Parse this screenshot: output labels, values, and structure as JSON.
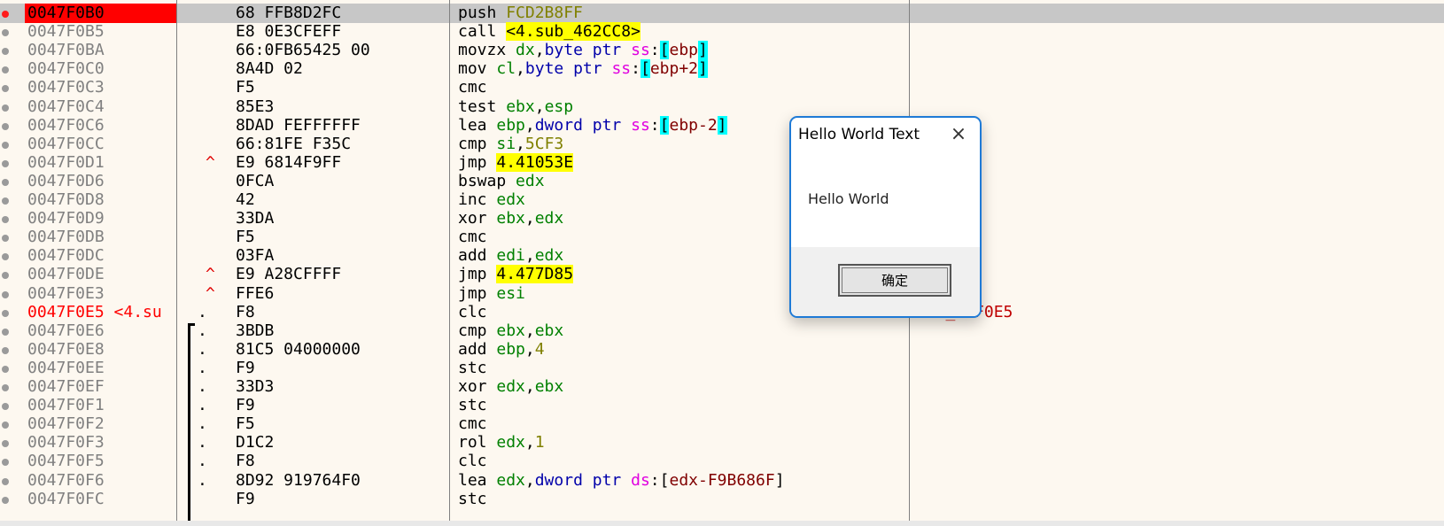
{
  "disassembly": {
    "rows": [
      {
        "addr": "0047F0B0",
        "bytes": "68 FFB8D2FC",
        "mark": "",
        "dot": "",
        "comment": "",
        "state": "current",
        "instr": [
          {
            "t": "push",
            "c": "mn push"
          },
          {
            "t": " ",
            "c": "tx"
          },
          {
            "t": "FCD2B8FF",
            "c": "num"
          }
        ]
      },
      {
        "addr": "0047F0B5",
        "bytes": "E8 0E3CFEFF",
        "mark": "",
        "dot": "",
        "comment": "",
        "state": "",
        "instr": [
          {
            "t": "call",
            "c": "mn call"
          },
          {
            "t": " ",
            "c": "tx"
          },
          {
            "t": "<4.sub_462CC8>",
            "c": "tgtc"
          }
        ]
      },
      {
        "addr": "0047F0BA",
        "bytes": "66:0FB65425 00",
        "mark": "",
        "dot": "",
        "comment": "",
        "state": "",
        "instr": [
          {
            "t": "movzx",
            "c": "mn"
          },
          {
            "t": " ",
            "c": "tx"
          },
          {
            "t": "dx",
            "c": "reg"
          },
          {
            "t": ",",
            "c": "tx"
          },
          {
            "t": "byte ptr",
            "c": "sz"
          },
          {
            "t": " ",
            "c": "tx"
          },
          {
            "t": "ss",
            "c": "seg"
          },
          {
            "t": ":",
            "c": "tx"
          },
          {
            "t": "[",
            "c": "br"
          },
          {
            "t": "ebp",
            "c": "mem"
          },
          {
            "t": "]",
            "c": "br"
          }
        ]
      },
      {
        "addr": "0047F0C0",
        "bytes": "8A4D 02",
        "mark": "",
        "dot": "",
        "comment": "",
        "state": "",
        "instr": [
          {
            "t": "mov",
            "c": "mn"
          },
          {
            "t": " ",
            "c": "tx"
          },
          {
            "t": "cl",
            "c": "reg"
          },
          {
            "t": ",",
            "c": "tx"
          },
          {
            "t": "byte ptr",
            "c": "sz"
          },
          {
            "t": " ",
            "c": "tx"
          },
          {
            "t": "ss",
            "c": "seg"
          },
          {
            "t": ":",
            "c": "tx"
          },
          {
            "t": "[",
            "c": "br"
          },
          {
            "t": "ebp+2",
            "c": "mem"
          },
          {
            "t": "]",
            "c": "br"
          }
        ]
      },
      {
        "addr": "0047F0C3",
        "bytes": "F5",
        "mark": "",
        "dot": "",
        "comment": "",
        "state": "",
        "instr": [
          {
            "t": "cmc",
            "c": "mn"
          }
        ]
      },
      {
        "addr": "0047F0C4",
        "bytes": "85E3",
        "mark": "",
        "dot": "",
        "comment": "",
        "state": "",
        "instr": [
          {
            "t": "test",
            "c": "mn"
          },
          {
            "t": " ",
            "c": "tx"
          },
          {
            "t": "ebx",
            "c": "reg"
          },
          {
            "t": ",",
            "c": "tx"
          },
          {
            "t": "esp",
            "c": "reg"
          }
        ]
      },
      {
        "addr": "0047F0C6",
        "bytes": "8DAD FEFFFFFF",
        "mark": "",
        "dot": "",
        "comment": "",
        "state": "",
        "instr": [
          {
            "t": "lea",
            "c": "mn"
          },
          {
            "t": " ",
            "c": "tx"
          },
          {
            "t": "ebp",
            "c": "reg"
          },
          {
            "t": ",",
            "c": "tx"
          },
          {
            "t": "dword ptr",
            "c": "sz"
          },
          {
            "t": " ",
            "c": "tx"
          },
          {
            "t": "ss",
            "c": "seg"
          },
          {
            "t": ":",
            "c": "tx"
          },
          {
            "t": "[",
            "c": "br"
          },
          {
            "t": "ebp-2",
            "c": "mem"
          },
          {
            "t": "]",
            "c": "br"
          }
        ]
      },
      {
        "addr": "0047F0CC",
        "bytes": "66:81FE F35C",
        "mark": "",
        "dot": "",
        "comment": "",
        "state": "",
        "instr": [
          {
            "t": "cmp",
            "c": "mn"
          },
          {
            "t": " ",
            "c": "tx"
          },
          {
            "t": "si",
            "c": "reg"
          },
          {
            "t": ",",
            "c": "tx"
          },
          {
            "t": "5CF3",
            "c": "num"
          }
        ]
      },
      {
        "addr": "0047F0D1",
        "bytes": "E9 6814F9FF",
        "mark": "^",
        "dot": "",
        "comment": "",
        "state": "",
        "instr": [
          {
            "t": "jmp",
            "c": "mn jmp"
          },
          {
            "t": " ",
            "c": "tx"
          },
          {
            "t": "4.41053E",
            "c": "tgt"
          }
        ]
      },
      {
        "addr": "0047F0D6",
        "bytes": "0FCA",
        "mark": "",
        "dot": "",
        "comment": "",
        "state": "",
        "instr": [
          {
            "t": "bswap",
            "c": "mn"
          },
          {
            "t": " ",
            "c": "tx"
          },
          {
            "t": "edx",
            "c": "reg"
          }
        ]
      },
      {
        "addr": "0047F0D8",
        "bytes": "42",
        "mark": "",
        "dot": "",
        "comment": "",
        "state": "",
        "instr": [
          {
            "t": "inc",
            "c": "mn"
          },
          {
            "t": " ",
            "c": "tx"
          },
          {
            "t": "edx",
            "c": "reg"
          }
        ]
      },
      {
        "addr": "0047F0D9",
        "bytes": "33DA",
        "mark": "",
        "dot": "",
        "comment": "",
        "state": "",
        "instr": [
          {
            "t": "xor",
            "c": "mn"
          },
          {
            "t": " ",
            "c": "tx"
          },
          {
            "t": "ebx",
            "c": "reg"
          },
          {
            "t": ",",
            "c": "tx"
          },
          {
            "t": "edx",
            "c": "reg"
          }
        ]
      },
      {
        "addr": "0047F0DB",
        "bytes": "F5",
        "mark": "",
        "dot": "",
        "comment": "",
        "state": "",
        "instr": [
          {
            "t": "cmc",
            "c": "mn"
          }
        ]
      },
      {
        "addr": "0047F0DC",
        "bytes": "03FA",
        "mark": "",
        "dot": "",
        "comment": "",
        "state": "",
        "instr": [
          {
            "t": "add",
            "c": "mn"
          },
          {
            "t": " ",
            "c": "tx"
          },
          {
            "t": "edi",
            "c": "reg"
          },
          {
            "t": ",",
            "c": "tx"
          },
          {
            "t": "edx",
            "c": "reg"
          }
        ]
      },
      {
        "addr": "0047F0DE",
        "bytes": "E9 A28CFFFF",
        "mark": "^",
        "dot": "",
        "comment": "",
        "state": "",
        "instr": [
          {
            "t": "jmp",
            "c": "mn jmp"
          },
          {
            "t": " ",
            "c": "tx"
          },
          {
            "t": "4.477D85",
            "c": "tgt"
          }
        ]
      },
      {
        "addr": "0047F0E3",
        "bytes": "FFE6",
        "mark": "^",
        "dot": "",
        "comment": "",
        "state": "",
        "instr": [
          {
            "t": "jmp",
            "c": "mn jmp"
          },
          {
            "t": " ",
            "c": "tx"
          },
          {
            "t": "esi",
            "c": "reg"
          }
        ]
      },
      {
        "addr": "0047F0E5 <4.su",
        "bytes": "F8",
        "mark": "",
        "dot": ".",
        "comment": "sub_47F0E5",
        "state": "label",
        "instr": [
          {
            "t": "clc",
            "c": "mn"
          }
        ]
      },
      {
        "addr": "0047F0E6",
        "bytes": "3BDB",
        "mark": "",
        "dot": ".",
        "comment": "",
        "state": "",
        "instr": [
          {
            "t": "cmp",
            "c": "mn"
          },
          {
            "t": " ",
            "c": "tx"
          },
          {
            "t": "ebx",
            "c": "reg"
          },
          {
            "t": ",",
            "c": "tx"
          },
          {
            "t": "ebx",
            "c": "reg"
          }
        ]
      },
      {
        "addr": "0047F0E8",
        "bytes": "81C5 04000000",
        "mark": "",
        "dot": ".",
        "comment": "",
        "state": "",
        "instr": [
          {
            "t": "add",
            "c": "mn"
          },
          {
            "t": " ",
            "c": "tx"
          },
          {
            "t": "ebp",
            "c": "reg"
          },
          {
            "t": ",",
            "c": "tx"
          },
          {
            "t": "4",
            "c": "num"
          }
        ]
      },
      {
        "addr": "0047F0EE",
        "bytes": "F9",
        "mark": "",
        "dot": ".",
        "comment": "",
        "state": "",
        "instr": [
          {
            "t": "stc",
            "c": "mn"
          }
        ]
      },
      {
        "addr": "0047F0EF",
        "bytes": "33D3",
        "mark": "",
        "dot": ".",
        "comment": "",
        "state": "",
        "instr": [
          {
            "t": "xor",
            "c": "mn"
          },
          {
            "t": " ",
            "c": "tx"
          },
          {
            "t": "edx",
            "c": "reg"
          },
          {
            "t": ",",
            "c": "tx"
          },
          {
            "t": "ebx",
            "c": "reg"
          }
        ]
      },
      {
        "addr": "0047F0F1",
        "bytes": "F9",
        "mark": "",
        "dot": ".",
        "comment": "",
        "state": "",
        "instr": [
          {
            "t": "stc",
            "c": "mn"
          }
        ]
      },
      {
        "addr": "0047F0F2",
        "bytes": "F5",
        "mark": "",
        "dot": ".",
        "comment": "",
        "state": "",
        "instr": [
          {
            "t": "cmc",
            "c": "mn"
          }
        ]
      },
      {
        "addr": "0047F0F3",
        "bytes": "D1C2",
        "mark": "",
        "dot": ".",
        "comment": "",
        "state": "",
        "instr": [
          {
            "t": "rol",
            "c": "mn"
          },
          {
            "t": " ",
            "c": "tx"
          },
          {
            "t": "edx",
            "c": "reg"
          },
          {
            "t": ",",
            "c": "tx"
          },
          {
            "t": "1",
            "c": "num"
          }
        ]
      },
      {
        "addr": "0047F0F5",
        "bytes": "F8",
        "mark": "",
        "dot": ".",
        "comment": "",
        "state": "",
        "instr": [
          {
            "t": "clc",
            "c": "mn"
          }
        ]
      },
      {
        "addr": "0047F0F6",
        "bytes": "8D92 919764F0",
        "mark": "",
        "dot": ".",
        "comment": "",
        "state": "",
        "instr": [
          {
            "t": "lea",
            "c": "mn"
          },
          {
            "t": " ",
            "c": "tx"
          },
          {
            "t": "edx",
            "c": "reg"
          },
          {
            "t": ",",
            "c": "tx"
          },
          {
            "t": "dword ptr",
            "c": "sz"
          },
          {
            "t": " ",
            "c": "tx"
          },
          {
            "t": "ds",
            "c": "seg"
          },
          {
            "t": ":",
            "c": "tx"
          },
          {
            "t": "[",
            "c": "tx"
          },
          {
            "t": "edx-F9B686F",
            "c": "mem"
          },
          {
            "t": "]",
            "c": "tx"
          }
        ]
      },
      {
        "addr": "0047F0FC",
        "bytes": "F9",
        "mark": "",
        "dot": "",
        "comment": "",
        "state": "",
        "instr": [
          {
            "t": "stc",
            "c": "mn"
          }
        ]
      }
    ]
  },
  "dialog": {
    "title": "Hello World Text",
    "close_icon": "×",
    "message": "Hello World",
    "ok_label": "确定"
  },
  "colors": {
    "current_row": "#c7c7c7",
    "current_addr": "#ff0000",
    "breakpoint": "#ff1a1a",
    "call_highlight": "#00ffff",
    "jmp_highlight": "#ffff00",
    "dialog_border": "#1e7ad6"
  }
}
